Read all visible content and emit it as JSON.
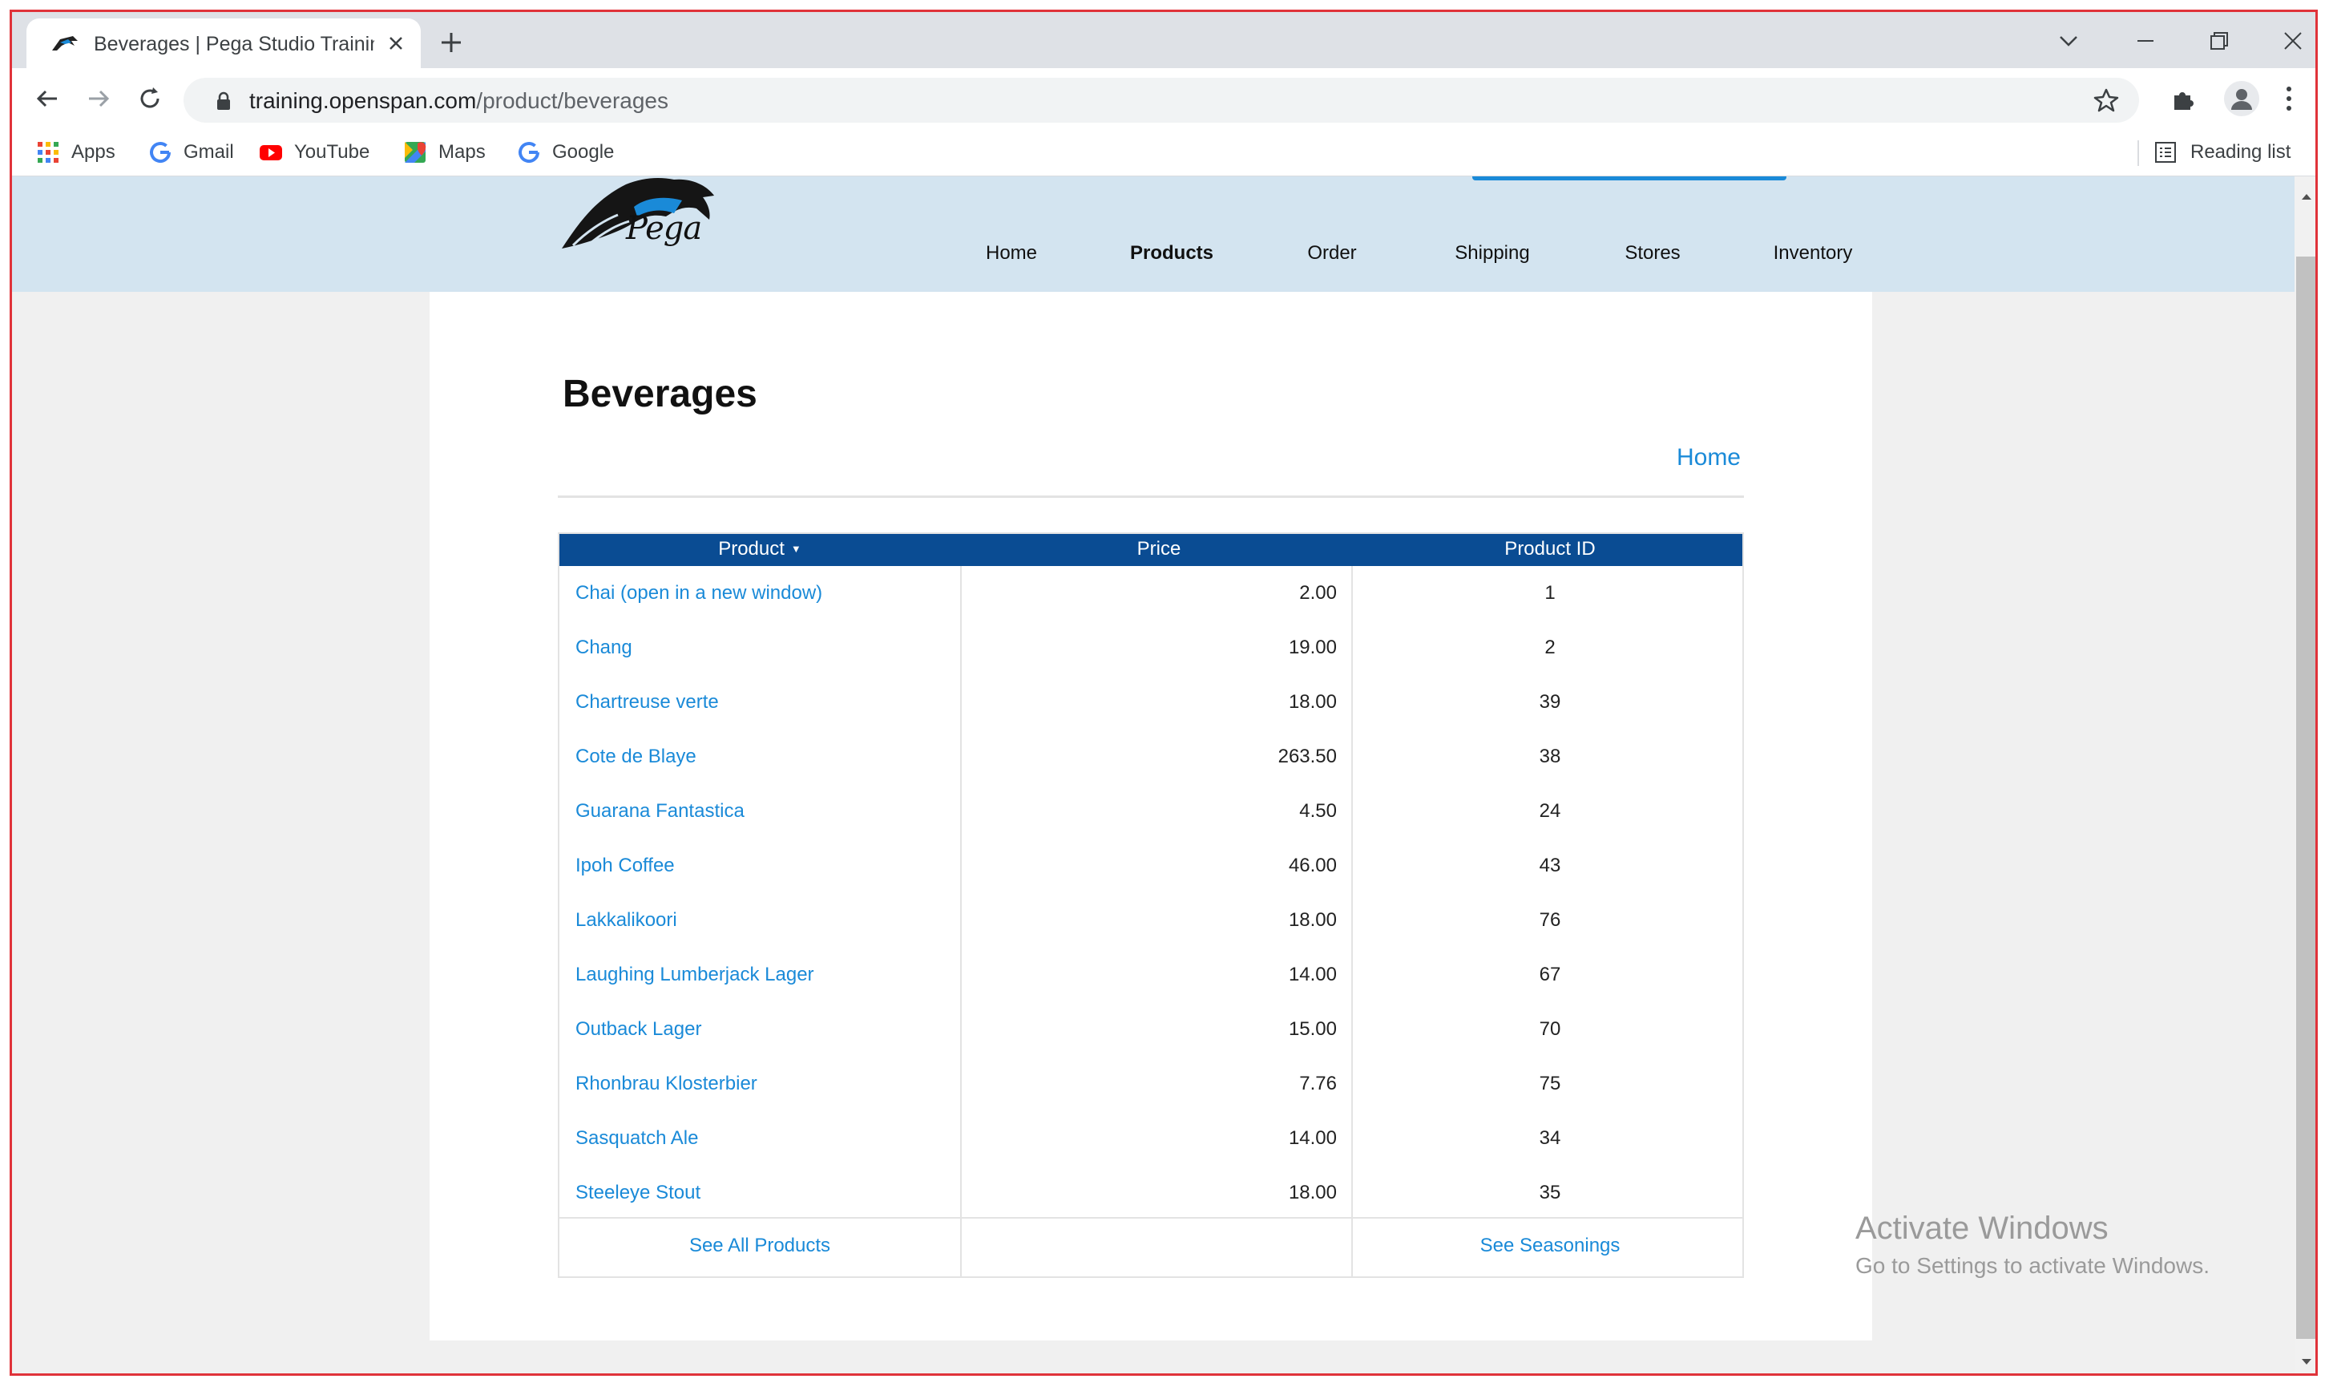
{
  "browser": {
    "tab": {
      "title": "Beverages | Pega Studio Training"
    },
    "address": {
      "host": "training.openspan.com",
      "path": "/product/beverages"
    },
    "bookmarks": [
      {
        "label": "Apps",
        "icon": "apps-grid-icon"
      },
      {
        "label": "Gmail",
        "icon": "google-g-icon"
      },
      {
        "label": "YouTube",
        "icon": "youtube-icon"
      },
      {
        "label": "Maps",
        "icon": "maps-icon"
      },
      {
        "label": "Google",
        "icon": "google-g-icon"
      }
    ],
    "reading_list": "Reading list"
  },
  "site": {
    "logo_text": "Pega",
    "nav": [
      "Home",
      "Products",
      "Order",
      "Shipping",
      "Stores",
      "Inventory"
    ],
    "active_nav": "Products"
  },
  "page": {
    "title": "Beverages",
    "home_link": "Home",
    "table": {
      "headers": [
        "Product",
        "Price",
        "Product ID"
      ],
      "sorted_by": "Product",
      "rows": [
        {
          "product": "Chai  (open in a new window)",
          "price": "2.00",
          "id": "1"
        },
        {
          "product": "Chang",
          "price": "19.00",
          "id": "2"
        },
        {
          "product": "Chartreuse verte",
          "price": "18.00",
          "id": "39"
        },
        {
          "product": "Cote de Blaye",
          "price": "263.50",
          "id": "38"
        },
        {
          "product": "Guarana Fantastica",
          "price": "4.50",
          "id": "24"
        },
        {
          "product": "Ipoh Coffee",
          "price": "46.00",
          "id": "43"
        },
        {
          "product": "Lakkalikoori",
          "price": "18.00",
          "id": "76"
        },
        {
          "product": "Laughing Lumberjack Lager",
          "price": "14.00",
          "id": "67"
        },
        {
          "product": "Outback Lager",
          "price": "15.00",
          "id": "70"
        },
        {
          "product": "Rhonbrau Klosterbier",
          "price": "7.76",
          "id": "75"
        },
        {
          "product": "Sasquatch Ale",
          "price": "14.00",
          "id": "34"
        },
        {
          "product": "Steeleye Stout",
          "price": "18.00",
          "id": "35"
        }
      ],
      "footer": {
        "see_all": "See All Products",
        "see_seasonings": "See Seasonings"
      }
    }
  },
  "watermark": {
    "title": "Activate Windows",
    "subtitle": "Go to Settings to activate Windows."
  },
  "colors": {
    "accent": "#1a8ad8",
    "table_header": "#0a4c93",
    "site_header": "#d3e4f0",
    "frame_border": "#e0333a"
  }
}
